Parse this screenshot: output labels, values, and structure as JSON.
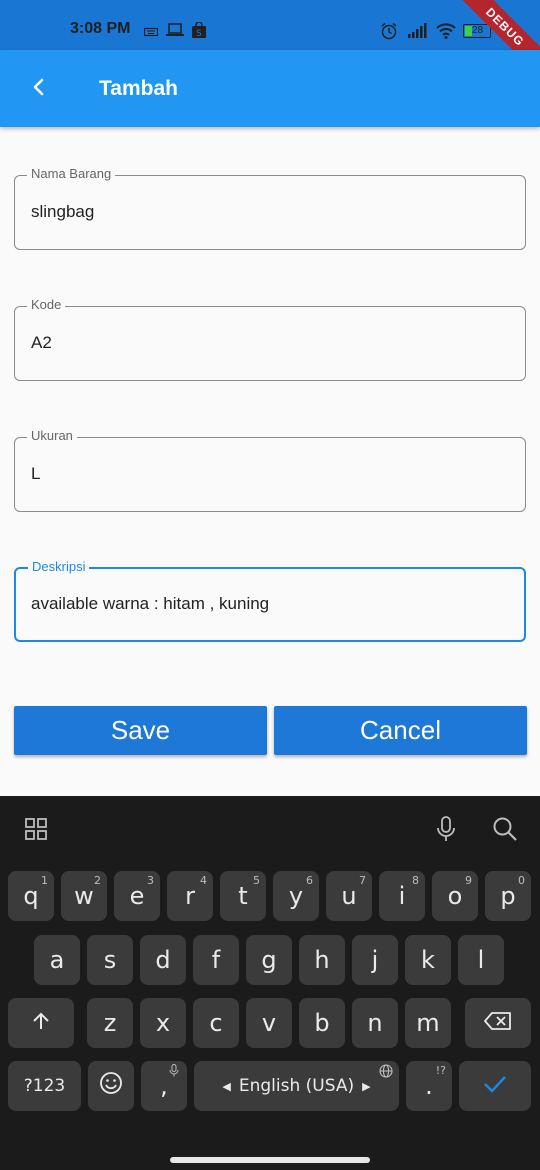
{
  "status_bar": {
    "time": "3:08 PM",
    "battery_level": "28",
    "debug_banner": "DEBUG",
    "icons": [
      "keyboard-icon",
      "laptop-icon",
      "shopping-bag-icon",
      "alarm-icon",
      "signal-icon",
      "wifi-icon",
      "battery-icon"
    ]
  },
  "app_bar": {
    "title": "Tambah",
    "back_icon": "chevron-left-icon"
  },
  "form": {
    "fields": [
      {
        "label": "Nama Barang",
        "value": "slingbag"
      },
      {
        "label": "Kode",
        "value": "A2"
      },
      {
        "label": "Ukuran",
        "value": "L"
      },
      {
        "label": "Deskripsi",
        "value": "available warna : hitam , kuning"
      }
    ],
    "save_label": "Save",
    "cancel_label": "Cancel"
  },
  "keyboard": {
    "row1": [
      {
        "key": "q",
        "hint": "1"
      },
      {
        "key": "w",
        "hint": "2"
      },
      {
        "key": "e",
        "hint": "3"
      },
      {
        "key": "r",
        "hint": "4"
      },
      {
        "key": "t",
        "hint": "5"
      },
      {
        "key": "y",
        "hint": "6"
      },
      {
        "key": "u",
        "hint": "7"
      },
      {
        "key": "i",
        "hint": "8"
      },
      {
        "key": "o",
        "hint": "9"
      },
      {
        "key": "p",
        "hint": "0"
      }
    ],
    "row2": [
      "a",
      "s",
      "d",
      "f",
      "g",
      "h",
      "j",
      "k",
      "l"
    ],
    "row3": [
      "z",
      "x",
      "c",
      "v",
      "b",
      "n",
      "m"
    ],
    "symbols_label": "?123",
    "comma": ",",
    "period": ".",
    "period_hint": "!?",
    "language_label": "English (USA)",
    "colors": {
      "enter_check": "#1e88e5",
      "focus": "#1e88e5",
      "button": "#1e78d7",
      "app_bar": "#2196f3"
    }
  }
}
